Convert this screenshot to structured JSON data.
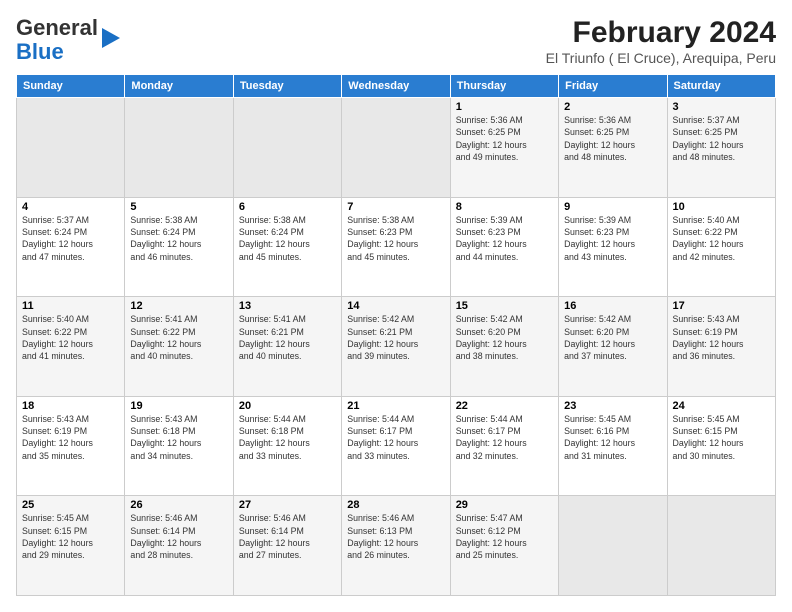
{
  "logo": {
    "general": "General",
    "blue": "Blue"
  },
  "header": {
    "title": "February 2024",
    "subtitle": "El Triunfo ( El Cruce), Arequipa, Peru"
  },
  "weekdays": [
    "Sunday",
    "Monday",
    "Tuesday",
    "Wednesday",
    "Thursday",
    "Friday",
    "Saturday"
  ],
  "weeks": [
    [
      {
        "day": "",
        "info": ""
      },
      {
        "day": "",
        "info": ""
      },
      {
        "day": "",
        "info": ""
      },
      {
        "day": "",
        "info": ""
      },
      {
        "day": "1",
        "info": "Sunrise: 5:36 AM\nSunset: 6:25 PM\nDaylight: 12 hours\nand 49 minutes."
      },
      {
        "day": "2",
        "info": "Sunrise: 5:36 AM\nSunset: 6:25 PM\nDaylight: 12 hours\nand 48 minutes."
      },
      {
        "day": "3",
        "info": "Sunrise: 5:37 AM\nSunset: 6:25 PM\nDaylight: 12 hours\nand 48 minutes."
      }
    ],
    [
      {
        "day": "4",
        "info": "Sunrise: 5:37 AM\nSunset: 6:24 PM\nDaylight: 12 hours\nand 47 minutes."
      },
      {
        "day": "5",
        "info": "Sunrise: 5:38 AM\nSunset: 6:24 PM\nDaylight: 12 hours\nand 46 minutes."
      },
      {
        "day": "6",
        "info": "Sunrise: 5:38 AM\nSunset: 6:24 PM\nDaylight: 12 hours\nand 45 minutes."
      },
      {
        "day": "7",
        "info": "Sunrise: 5:38 AM\nSunset: 6:23 PM\nDaylight: 12 hours\nand 45 minutes."
      },
      {
        "day": "8",
        "info": "Sunrise: 5:39 AM\nSunset: 6:23 PM\nDaylight: 12 hours\nand 44 minutes."
      },
      {
        "day": "9",
        "info": "Sunrise: 5:39 AM\nSunset: 6:23 PM\nDaylight: 12 hours\nand 43 minutes."
      },
      {
        "day": "10",
        "info": "Sunrise: 5:40 AM\nSunset: 6:22 PM\nDaylight: 12 hours\nand 42 minutes."
      }
    ],
    [
      {
        "day": "11",
        "info": "Sunrise: 5:40 AM\nSunset: 6:22 PM\nDaylight: 12 hours\nand 41 minutes."
      },
      {
        "day": "12",
        "info": "Sunrise: 5:41 AM\nSunset: 6:22 PM\nDaylight: 12 hours\nand 40 minutes."
      },
      {
        "day": "13",
        "info": "Sunrise: 5:41 AM\nSunset: 6:21 PM\nDaylight: 12 hours\nand 40 minutes."
      },
      {
        "day": "14",
        "info": "Sunrise: 5:42 AM\nSunset: 6:21 PM\nDaylight: 12 hours\nand 39 minutes."
      },
      {
        "day": "15",
        "info": "Sunrise: 5:42 AM\nSunset: 6:20 PM\nDaylight: 12 hours\nand 38 minutes."
      },
      {
        "day": "16",
        "info": "Sunrise: 5:42 AM\nSunset: 6:20 PM\nDaylight: 12 hours\nand 37 minutes."
      },
      {
        "day": "17",
        "info": "Sunrise: 5:43 AM\nSunset: 6:19 PM\nDaylight: 12 hours\nand 36 minutes."
      }
    ],
    [
      {
        "day": "18",
        "info": "Sunrise: 5:43 AM\nSunset: 6:19 PM\nDaylight: 12 hours\nand 35 minutes."
      },
      {
        "day": "19",
        "info": "Sunrise: 5:43 AM\nSunset: 6:18 PM\nDaylight: 12 hours\nand 34 minutes."
      },
      {
        "day": "20",
        "info": "Sunrise: 5:44 AM\nSunset: 6:18 PM\nDaylight: 12 hours\nand 33 minutes."
      },
      {
        "day": "21",
        "info": "Sunrise: 5:44 AM\nSunset: 6:17 PM\nDaylight: 12 hours\nand 33 minutes."
      },
      {
        "day": "22",
        "info": "Sunrise: 5:44 AM\nSunset: 6:17 PM\nDaylight: 12 hours\nand 32 minutes."
      },
      {
        "day": "23",
        "info": "Sunrise: 5:45 AM\nSunset: 6:16 PM\nDaylight: 12 hours\nand 31 minutes."
      },
      {
        "day": "24",
        "info": "Sunrise: 5:45 AM\nSunset: 6:15 PM\nDaylight: 12 hours\nand 30 minutes."
      }
    ],
    [
      {
        "day": "25",
        "info": "Sunrise: 5:45 AM\nSunset: 6:15 PM\nDaylight: 12 hours\nand 29 minutes."
      },
      {
        "day": "26",
        "info": "Sunrise: 5:46 AM\nSunset: 6:14 PM\nDaylight: 12 hours\nand 28 minutes."
      },
      {
        "day": "27",
        "info": "Sunrise: 5:46 AM\nSunset: 6:14 PM\nDaylight: 12 hours\nand 27 minutes."
      },
      {
        "day": "28",
        "info": "Sunrise: 5:46 AM\nSunset: 6:13 PM\nDaylight: 12 hours\nand 26 minutes."
      },
      {
        "day": "29",
        "info": "Sunrise: 5:47 AM\nSunset: 6:12 PM\nDaylight: 12 hours\nand 25 minutes."
      },
      {
        "day": "",
        "info": ""
      },
      {
        "day": "",
        "info": ""
      }
    ]
  ]
}
